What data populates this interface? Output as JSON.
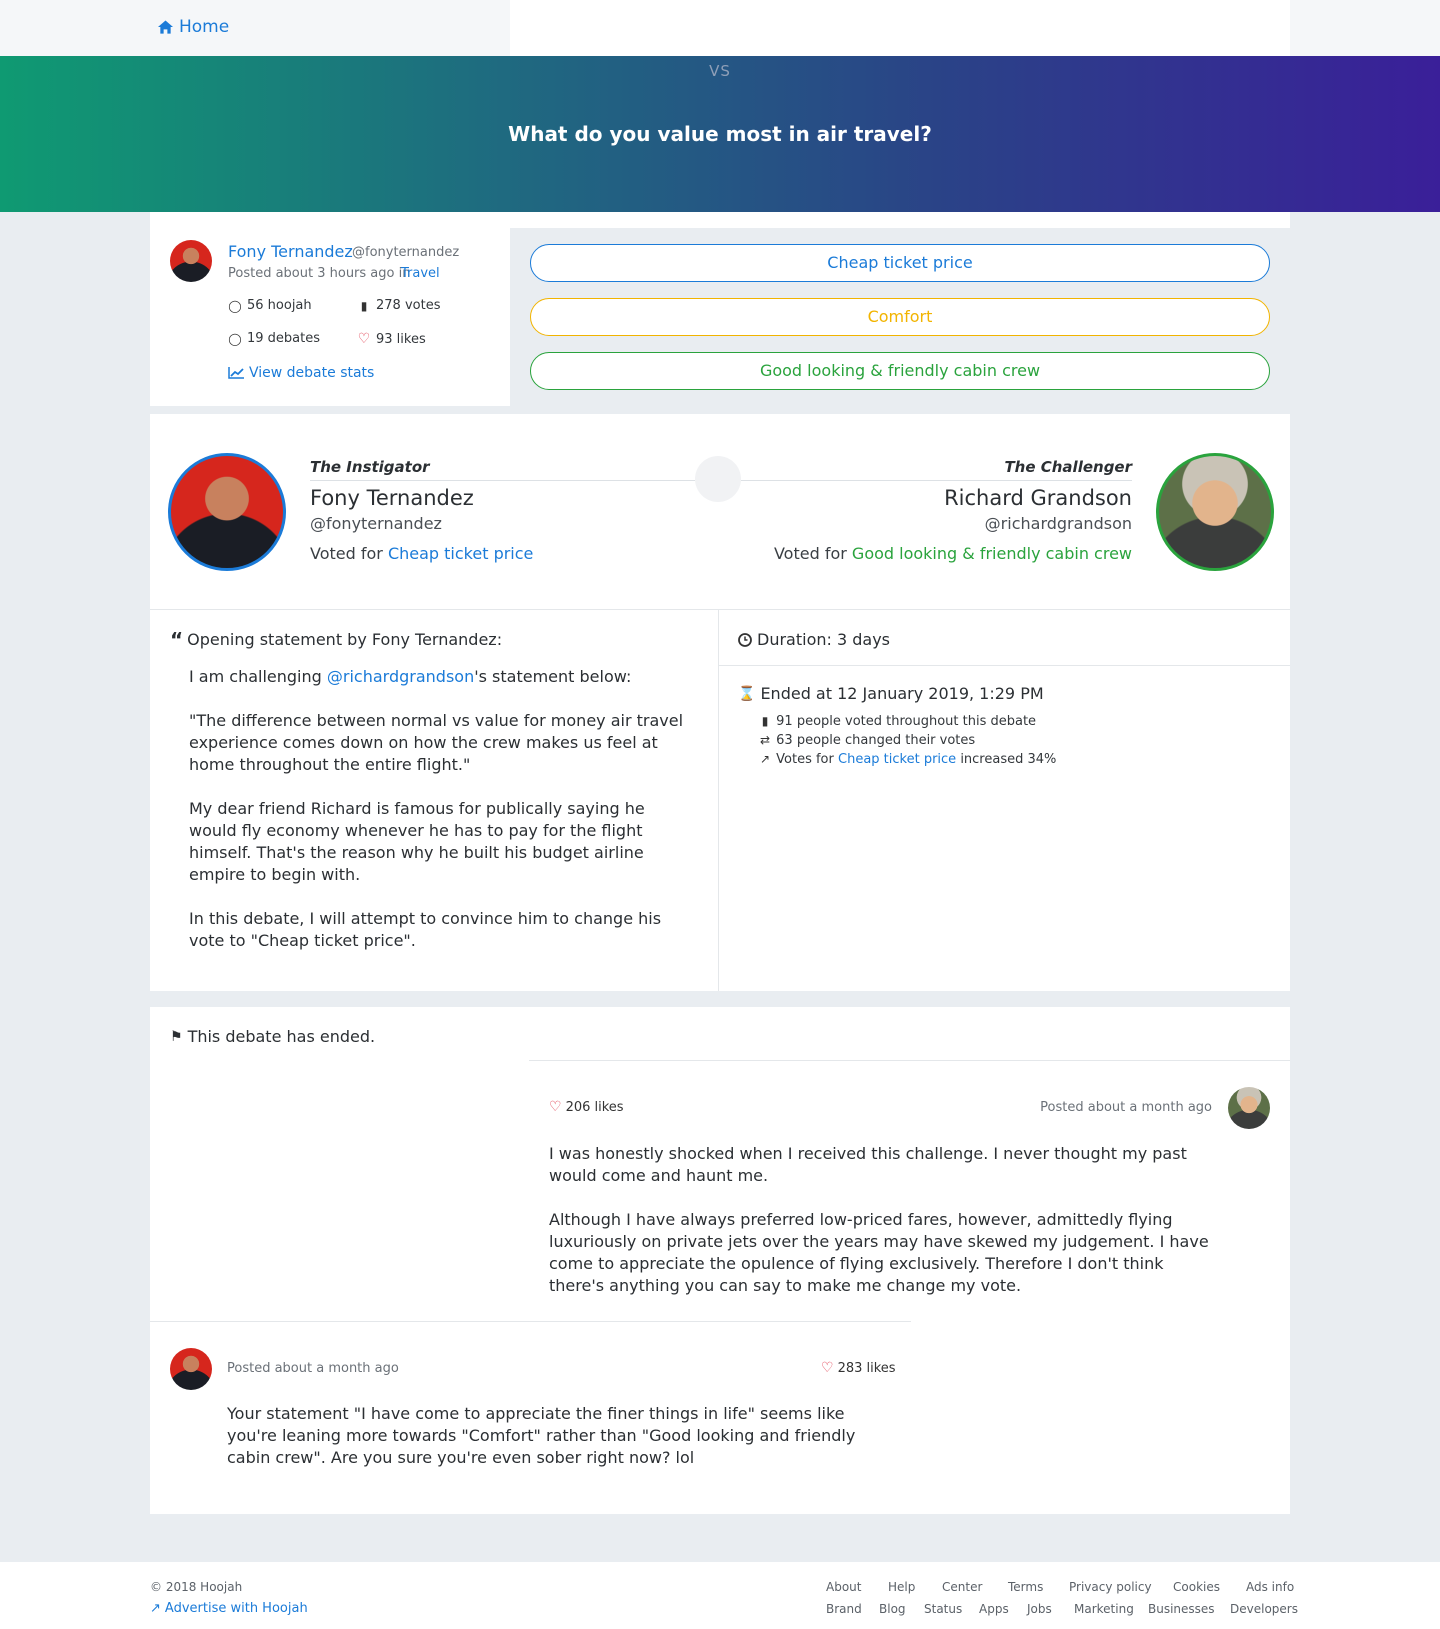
{
  "nav": {
    "home_label": "Home"
  },
  "hero": {
    "vs": "VS",
    "question": "What do you value most in air travel?"
  },
  "author": {
    "name": "Fony Ternandez",
    "handle": "@fonyternandez",
    "posted_prefix": "Posted about 3 hours ago in",
    "category": "Travel",
    "stats": {
      "hoojah": "56 hoojah",
      "votes": "278 votes",
      "debates": "19 debates",
      "likes": "93 likes"
    },
    "view_stats": "View debate stats"
  },
  "options": [
    {
      "label": "Cheap ticket price",
      "color": "#1b7bd8"
    },
    {
      "label": "Comfort",
      "color": "#f2b400"
    },
    {
      "label": "Good looking & friendly cabin crew",
      "color": "#2aa33d"
    }
  ],
  "instigator": {
    "role": "The Instigator",
    "name": "Fony Ternandez",
    "handle": "@fonyternandez",
    "voted_prefix": "Voted for",
    "voted_option": "Cheap ticket price"
  },
  "challenger": {
    "role": "The Challenger",
    "name": "Richard Grandson",
    "handle": "@richardgrandson",
    "voted_prefix": "Voted for",
    "voted_option": "Good looking & friendly cabin crew"
  },
  "opening": {
    "heading": "Opening statement by Fony Ternandez:",
    "p1_before": "I am challenging",
    "p1_mention": "@richardgrandson",
    "p1_after": "'s statement below:",
    "p2": "\"The difference between normal vs value for money air travel experience comes down on how the crew makes us feel at home throughout the entire flight.\"",
    "p3": "My dear friend Richard is famous for publically saying he would fly economy whenever he has to pay for the flight himself. That's the reason why he built his budget airline empire to begin with.",
    "p4": "In this debate, I will attempt to convince him to change his vote to \"Cheap ticket price\"."
  },
  "duration": {
    "label": "Duration: 3 days",
    "ended": "Ended at 12 January 2019, 1:29 PM",
    "voted": "91 people voted throughout this debate",
    "changed": "63 people changed their votes",
    "votes_prefix": "Votes for",
    "votes_option": "Cheap ticket price",
    "votes_suffix": "increased 34%"
  },
  "ended_notice": "This debate has ended.",
  "replies": [
    {
      "likes": "206 likes",
      "posted": "Posted about a month ago",
      "p1": "I was honestly shocked when I received this challenge. I never thought my past would come and haunt me.",
      "p2": "Although I have always preferred low-priced fares, however, admittedly flying luxuriously on private jets over the years may have skewed my judgement. I have come to appreciate the opulence of flying exclusively. Therefore I don't think there's anything you can say to make me change my vote."
    },
    {
      "likes": "283 likes",
      "posted": "Posted about a month ago",
      "p1": "Your statement \"I have come to appreciate the finer things in life\" seems like you're leaning more towards \"Comfort\" rather than \"Good looking and friendly cabin crew\". Are you sure you're even sober right now? lol"
    }
  ],
  "footer": {
    "copyright": "© 2018 Hoojah",
    "advertise": "Advertise with Hoojah",
    "row1": [
      "About",
      "Help",
      "Center",
      "Terms",
      "Privacy policy",
      "Cookies",
      "Ads info"
    ],
    "row2": [
      "Brand",
      "Blog",
      "Status",
      "Apps",
      "Jobs",
      "Marketing",
      "Businesses",
      "Developers"
    ]
  }
}
